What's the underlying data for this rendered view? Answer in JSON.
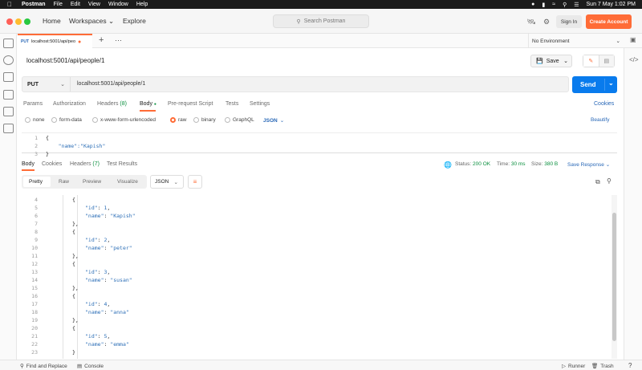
{
  "menubar": {
    "app": "Postman",
    "items": [
      "File",
      "Edit",
      "View",
      "Window",
      "Help"
    ],
    "datetime": "Sun 7 May  1:02 PM"
  },
  "header": {
    "nav": [
      "Home",
      "Workspaces",
      "Explore"
    ],
    "search_placeholder": "Search Postman",
    "sign_in": "Sign In",
    "create_account": "Create Account"
  },
  "tabs": {
    "open": [
      {
        "method": "PUT",
        "title": "localhost:5001/api/peo"
      }
    ],
    "environment": "No Environment"
  },
  "request": {
    "title": "localhost:5001/api/people/1",
    "save_label": "Save",
    "method": "PUT",
    "url": "localhost:5001/api/people/1",
    "send_label": "Send",
    "tabs": [
      "Params",
      "Authorization",
      "Headers",
      "Body",
      "Pre-request Script",
      "Tests",
      "Settings"
    ],
    "headers_count": "(8)",
    "cookies_link": "Cookies",
    "body_types": [
      "none",
      "form-data",
      "x-www-form-urlencoded",
      "raw",
      "binary",
      "GraphQL"
    ],
    "body_format": "JSON",
    "beautify": "Beautify",
    "body_lines": [
      {
        "n": "1",
        "text": "{"
      },
      {
        "n": "2",
        "text": "    \"name\":\"Kapish\""
      },
      {
        "n": "3",
        "text": "}"
      }
    ]
  },
  "response": {
    "tabs": [
      "Body",
      "Cookies",
      "Headers",
      "Test Results"
    ],
    "headers_count": "(7)",
    "status_label": "Status:",
    "status": "200 OK",
    "time_label": "Time:",
    "time": "30 ms",
    "size_label": "Size:",
    "size": "380 B",
    "save_response": "Save Response",
    "views": [
      "Pretty",
      "Raw",
      "Preview",
      "Visualize"
    ],
    "format": "JSON",
    "lines": [
      {
        "n": "4",
        "indent": 1,
        "text": "{"
      },
      {
        "n": "5",
        "indent": 2,
        "key": "\"id\"",
        "val": "1",
        "tail": ","
      },
      {
        "n": "6",
        "indent": 2,
        "key": "\"name\"",
        "val": "\"Kapish\"",
        "tail": ""
      },
      {
        "n": "7",
        "indent": 1,
        "text": "},"
      },
      {
        "n": "8",
        "indent": 1,
        "text": "{"
      },
      {
        "n": "9",
        "indent": 2,
        "key": "\"id\"",
        "val": "2",
        "tail": ","
      },
      {
        "n": "10",
        "indent": 2,
        "key": "\"name\"",
        "val": "\"peter\"",
        "tail": ""
      },
      {
        "n": "11",
        "indent": 1,
        "text": "},"
      },
      {
        "n": "12",
        "indent": 1,
        "text": "{"
      },
      {
        "n": "13",
        "indent": 2,
        "key": "\"id\"",
        "val": "3",
        "tail": ","
      },
      {
        "n": "14",
        "indent": 2,
        "key": "\"name\"",
        "val": "\"susan\"",
        "tail": ""
      },
      {
        "n": "15",
        "indent": 1,
        "text": "},"
      },
      {
        "n": "16",
        "indent": 1,
        "text": "{"
      },
      {
        "n": "17",
        "indent": 2,
        "key": "\"id\"",
        "val": "4",
        "tail": ","
      },
      {
        "n": "18",
        "indent": 2,
        "key": "\"name\"",
        "val": "\"anna\"",
        "tail": ""
      },
      {
        "n": "19",
        "indent": 1,
        "text": "},"
      },
      {
        "n": "20",
        "indent": 1,
        "text": "{"
      },
      {
        "n": "21",
        "indent": 2,
        "key": "\"id\"",
        "val": "5",
        "tail": ","
      },
      {
        "n": "22",
        "indent": 2,
        "key": "\"name\"",
        "val": "\"emma\"",
        "tail": ""
      },
      {
        "n": "23",
        "indent": 1,
        "text": "}"
      }
    ]
  },
  "footer": {
    "find_replace": "Find and Replace",
    "console": "Console",
    "runner": "Runner",
    "trash": "Trash"
  },
  "colors": {
    "accent": "#ff6c37",
    "send": "#097bed",
    "status_ok": "#0a8f3e"
  }
}
